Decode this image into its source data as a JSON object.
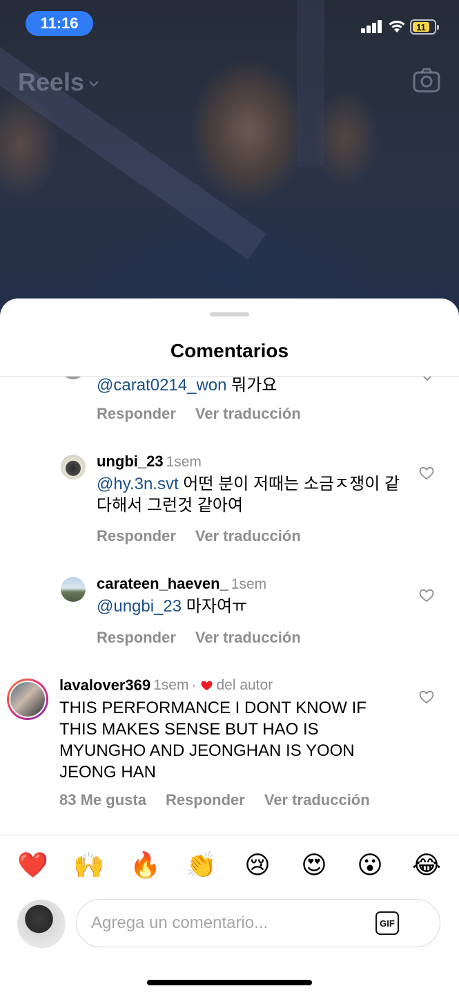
{
  "status_bar": {
    "time": "11:16",
    "battery_level": "11"
  },
  "reels_header": {
    "title": "Reels",
    "chevron_icon": "chevron-down-icon",
    "camera_icon": "camera-icon"
  },
  "sheet": {
    "title": "Comentarios"
  },
  "comments": [
    {
      "username": "",
      "time": "",
      "mention": "@carat0214_won",
      "text": " 뭐가요",
      "actions": [
        "Responder",
        "Ver traducción"
      ]
    },
    {
      "username": "ungbi_23",
      "time": "1sem",
      "mention": "@hy.3n.svt",
      "text": " 어떤 분이 저때는 소금ㅈ쟁이 같다해서 그런것 같아여",
      "actions": [
        "Responder",
        "Ver traducción"
      ]
    },
    {
      "username": "carateen_haeven_",
      "time": "1sem",
      "mention": "@ungbi_23",
      "text": " 마자여ㅠ",
      "actions": [
        "Responder",
        "Ver traducción"
      ]
    },
    {
      "username": "lavalover369",
      "time": "1sem",
      "author_badge": "del autor",
      "text": "THIS PERFORMANCE I DONT KNOW IF THIS MAKES SENSE BUT HAO IS MYUNGHO AND JEONGHAN IS YOON JEONG HAN",
      "likes": "83 Me gusta",
      "actions": [
        "Responder",
        "Ver traducción"
      ]
    }
  ],
  "emoji_reactions": [
    "❤️",
    "🙌",
    "🔥",
    "👏",
    "😢",
    "😍",
    "😮",
    "😂"
  ],
  "composer": {
    "placeholder": "Agrega un comentario...",
    "gif_label": "GIF"
  },
  "colors": {
    "time_pill": "#2f7cf6",
    "mention": "#1c4f88",
    "muted": "#8e8e8e",
    "author_heart": "#ed1c24"
  }
}
